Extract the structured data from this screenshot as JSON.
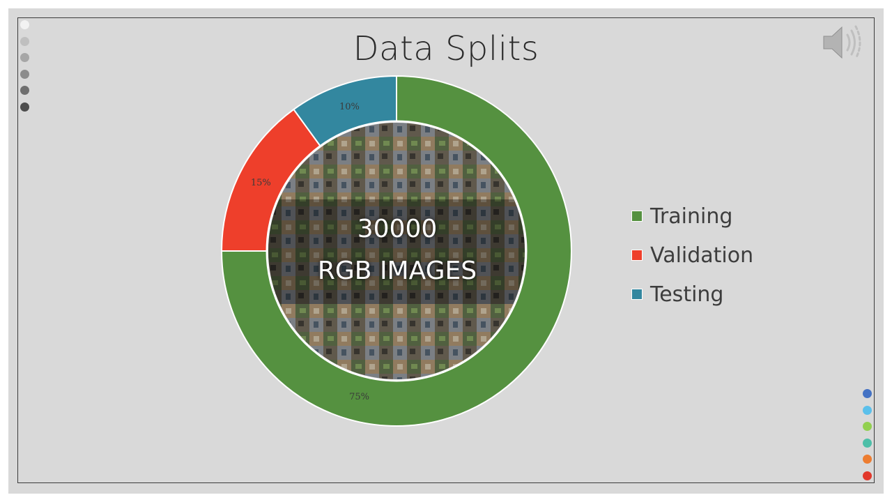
{
  "slide": {
    "title": "Data Splits",
    "center_line_1": "30000",
    "center_line_2": "RGB IMAGES",
    "speaker_icon": "speaker-icon",
    "left_dots": [
      "#f2f2f2",
      "#bfbfbf",
      "#a6a6a6",
      "#8c8c8c",
      "#6f6f6f",
      "#4d4d4d"
    ],
    "right_dots": [
      "#4472c4",
      "#5bc0eb",
      "#92d050",
      "#4dbfa8",
      "#ed7d31",
      "#e2382b"
    ]
  },
  "chart_data": {
    "type": "pie",
    "donut": true,
    "title": "Data Splits",
    "categories": [
      "Training",
      "Validation",
      "Testing"
    ],
    "values": [
      75,
      15,
      10
    ],
    "labels": [
      "75%",
      "15%",
      "10%"
    ],
    "colors": [
      "#559140",
      "#ee3f2b",
      "#33879f"
    ],
    "legend_position": "right"
  }
}
